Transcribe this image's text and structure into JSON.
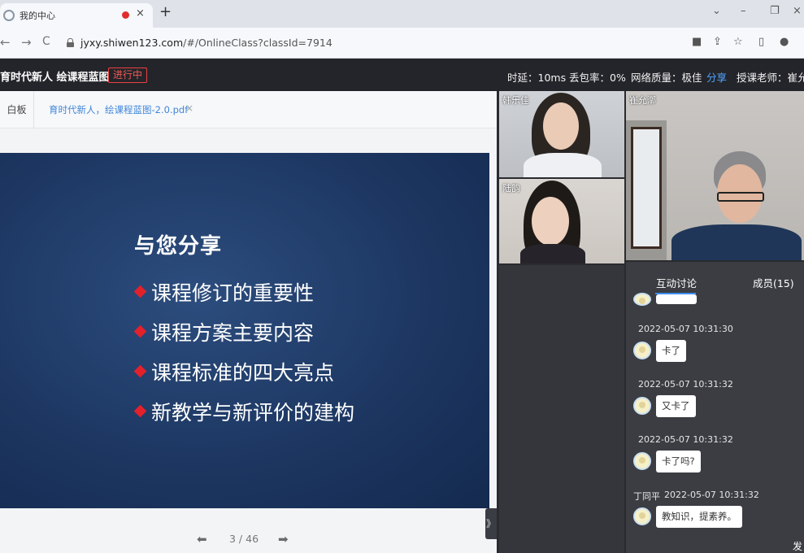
{
  "browser": {
    "tab_title": "我的中心",
    "tab_close": "×",
    "new_tab": "+",
    "url_host": "jyxy.shiwen123.com",
    "url_path": "/#/OnlineClass?classId=7914",
    "controls": {
      "dropdown": "⌄",
      "minimize": "–",
      "restore": "❐",
      "close": "×"
    },
    "nav": {
      "back": "←",
      "forward": "→",
      "reload": "C"
    }
  },
  "header": {
    "course_title": "育时代新人 绘课程蓝图",
    "status": "进行中",
    "latency": "时延：10ms",
    "packet_loss": "丢包率：0%",
    "network": "网络质量：极佳",
    "share": "分享",
    "teacher": "授课老师：崔允漷"
  },
  "doc": {
    "whiteboard_tab": "白板",
    "pdf_tab": "育时代新人，绘课程蓝图-2.0.pdf",
    "pdf_close": "×",
    "slide_title": "与您分享",
    "slide_items": [
      "课程修订的重要性",
      "课程方案主要内容",
      "课程标准的四大亮点",
      "新教学与新评价的建构"
    ],
    "page": "3 / 46",
    "prev": "⬅",
    "next": "➡",
    "collapse": "》"
  },
  "videos": {
    "v1_label": "韩乐佳",
    "v2_label": "陆韵",
    "v3_label": "崔允漷"
  },
  "chat": {
    "tab_discussion": "互动讨论",
    "tab_members": "成员(15)",
    "messages": [
      {
        "time": "2022-05-07 10:31:30",
        "text": "卡了"
      },
      {
        "time": "2022-05-07 10:31:32",
        "text": "又卡了"
      },
      {
        "time": "2022-05-07 10:31:32",
        "text": "卡了吗?"
      },
      {
        "sender": "丁同平",
        "time": "2022-05-07 10:31:32",
        "text": "教知识，提素养。"
      }
    ],
    "send": "发"
  }
}
